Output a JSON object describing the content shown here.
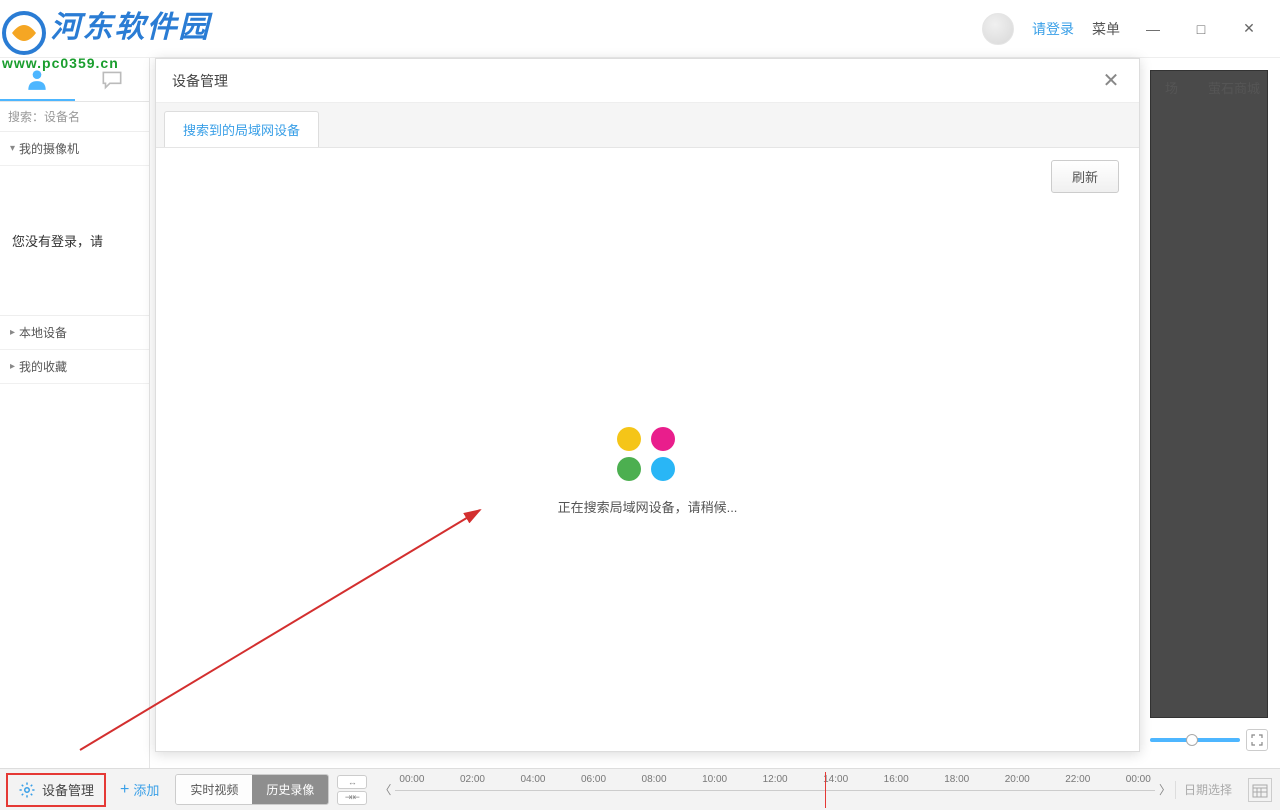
{
  "watermark": {
    "title": "河东软件园",
    "url": "www.pc0359.cn"
  },
  "topbar": {
    "login": "请登录",
    "menu": "菜单",
    "right_links": {
      "market": "场",
      "mall": "萤石商城"
    }
  },
  "sidebar": {
    "search_placeholder": "搜索：设备名",
    "my_camera": "我的摄像机",
    "login_msg": "您没有登录，请",
    "local_device": "本地设备",
    "my_favorites": "我的收藏"
  },
  "bottombar": {
    "device_mgmt": "设备管理",
    "add": "添加",
    "tab_live": "实时视频",
    "tab_history": "历史录像",
    "date_select": "日期选择",
    "timeline_ticks": [
      "00:00",
      "02:00",
      "04:00",
      "06:00",
      "08:00",
      "10:00",
      "12:00",
      "14:00",
      "16:00",
      "18:00",
      "20:00",
      "22:00",
      "00:00"
    ]
  },
  "modal": {
    "title": "设备管理",
    "tab_lan": "搜索到的局域网设备",
    "refresh": "刷新",
    "loading": "正在搜索局域网设备，请稍候..."
  }
}
